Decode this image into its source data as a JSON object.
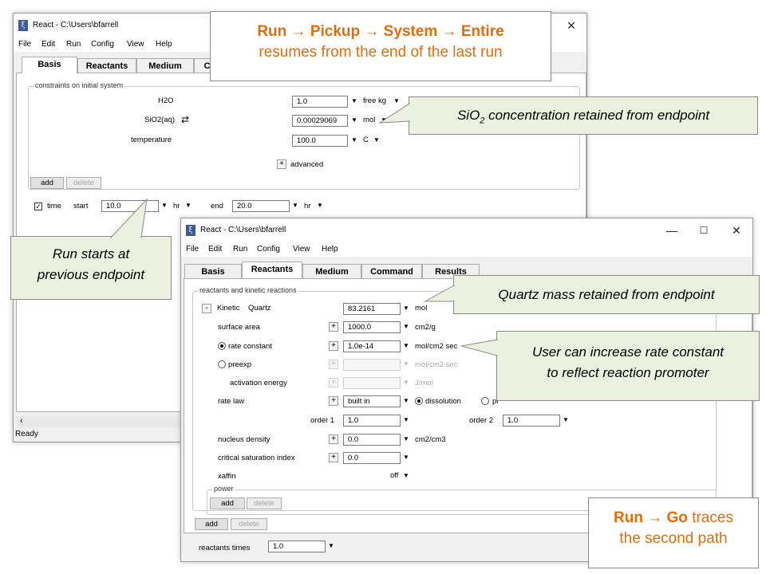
{
  "back_window": {
    "title": "React - C:\\Users\\bfarrell",
    "close_glyph": "✕",
    "menu": [
      "File",
      "Edit",
      "Run",
      "Config",
      "View",
      "Help"
    ],
    "tabs": [
      "Basis",
      "Reactants",
      "Medium",
      "Co"
    ],
    "group_label": "constraints on initial system",
    "rows": [
      {
        "label": "H2O",
        "value": "1.0",
        "unit": "free kg"
      },
      {
        "label": "SiO2(aq)",
        "value": "0.00029069",
        "unit": "mol"
      },
      {
        "label": "temperature",
        "value": "100.0",
        "unit": "C"
      }
    ],
    "advanced_label": "advanced",
    "add_label": "add",
    "delete_label": "delete",
    "time_label": "time",
    "start_label": "start",
    "start_value": "10.0",
    "start_unit": "hr",
    "end_label": "end",
    "end_value": "20.0",
    "end_unit": "hr",
    "status": "Ready"
  },
  "front_window": {
    "title": "React - C:\\Users\\bfarrell",
    "menu": [
      "File",
      "Edit",
      "Run",
      "Config",
      "View",
      "Help"
    ],
    "tabs": [
      "Basis",
      "Reactants",
      "Medium",
      "Command",
      "Results"
    ],
    "group_label": "reactants and kinetic reactions",
    "kinetic_label": "Kinetic",
    "mineral": "Quartz",
    "mineral_value": "83.2161",
    "mineral_unit": "mol",
    "surface_area_label": "surface area",
    "surface_area_value": "1000.0",
    "surface_area_unit": "cm2/g",
    "rate_constant_label": "rate constant",
    "rate_constant_value": "1.0e-14",
    "rate_constant_unit": "mol/cm2 sec",
    "preexp_label": "preexp",
    "preexp_unit": "mol/cm2 sec",
    "activation_energy_label": "activation energy",
    "activation_energy_unit": "J/mol",
    "rate_law_label": "rate law",
    "rate_law_value": "built in",
    "dissolution_label": "dissolution",
    "precipitation_label": "pr",
    "order1_label": "order 1",
    "order1_value": "1.0",
    "order2_label": "order 2",
    "order2_value": "1.0",
    "nucleus_density_label": "nucleus density",
    "nucleus_density_value": "0.0",
    "nucleus_density_unit": "cm2/cm3",
    "crit_sat_label": "critical saturation index",
    "crit_sat_value": "0.0",
    "xaffin_label": "xaffin",
    "xaffin_value": "off",
    "power_label": "power",
    "add_label": "add",
    "delete_label": "delete",
    "reactants_times_label": "reactants times",
    "reactants_times_value": "1.0"
  },
  "annotations": {
    "top_note_line1": "Run → Pickup → System → Entire",
    "top_note_line2": "resumes from the end of the last run",
    "sio2_callout_prefix": "SiO",
    "sio2_callout_sub": "2",
    "sio2_callout_suffix": " concentration retained from endpoint",
    "run_starts_line1": "Run starts at",
    "run_starts_line2": "previous endpoint",
    "quartz_callout": "Quartz mass retained from endpoint",
    "rate_callout_line1": "User can increase rate constant",
    "rate_callout_line2": "to reflect reaction promoter",
    "go_note_bold": "Run → Go",
    "go_note_rest": " traces",
    "go_note_line2": "the second path"
  },
  "colors": {
    "note_text": "#e46c0a",
    "callout_fill": "#ebf1de"
  }
}
